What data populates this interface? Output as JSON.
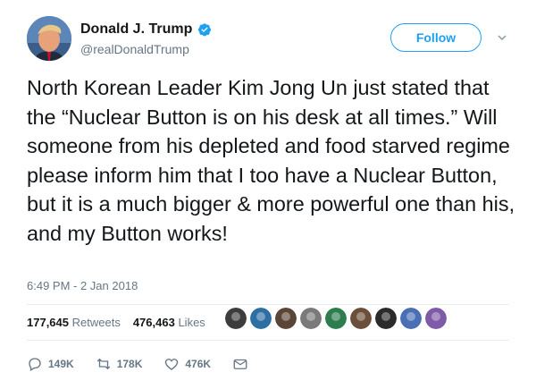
{
  "user": {
    "name": "Donald J. Trump",
    "handle": "@realDonaldTrump",
    "verified": true
  },
  "follow_label": "Follow",
  "tweet": {
    "text": "North Korean Leader Kim Jong Un just stated that the “Nuclear Button is on his desk at all times.” Will someone from his depleted and food starved regime please inform him that I too have a Nuclear Button, but it is a much bigger & more powerful one than his, and my Button works!",
    "timestamp": "6:49 PM - 2 Jan 2018"
  },
  "stats": {
    "retweets_count": "177,645",
    "retweets_label": "Retweets",
    "likes_count": "476,463",
    "likes_label": "Likes"
  },
  "liker_avatars": [
    {
      "name": "liker-1",
      "color": "#3d3d3d"
    },
    {
      "name": "liker-2",
      "color": "#2d6fa3"
    },
    {
      "name": "liker-3",
      "color": "#5a4636"
    },
    {
      "name": "liker-4",
      "color": "#7a7a7a"
    },
    {
      "name": "liker-5",
      "color": "#2e7d4f"
    },
    {
      "name": "liker-6",
      "color": "#6b4f3a"
    },
    {
      "name": "liker-7",
      "color": "#2b2b2b"
    },
    {
      "name": "liker-8",
      "color": "#4a6fb5"
    },
    {
      "name": "liker-9",
      "color": "#7e5aa8"
    }
  ],
  "actions": {
    "replies": "149K",
    "retweets": "178K",
    "likes": "476K"
  },
  "colors": {
    "accent": "#1da1f2",
    "secondary_text": "#657786",
    "divider": "#e6ecf0"
  },
  "icons": [
    "verified-badge-icon",
    "chevron-down-icon",
    "reply-icon",
    "retweet-icon",
    "like-icon",
    "direct-message-icon"
  ]
}
